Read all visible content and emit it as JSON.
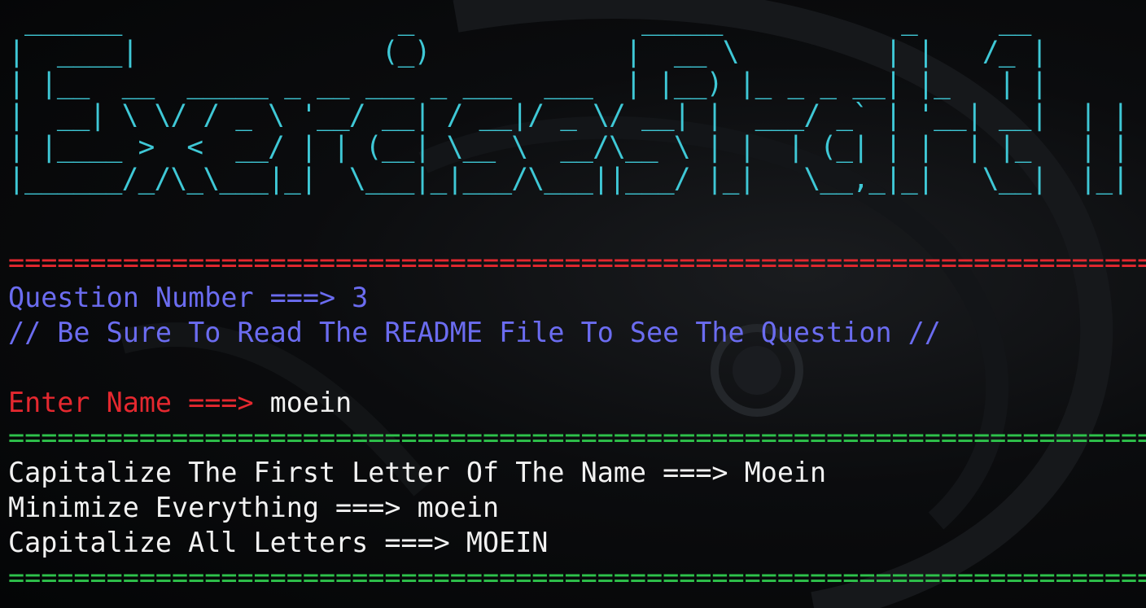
{
  "banner": {
    "text": " ______                 _              _____           _     __\n|  ____|               (_)            |  __ \\         | |   /_ |\n| |__  __  _____ _ __ ___ _ ___  ___  | |__) |_ _ _ __| |_   | |\n|  __| \\ \\/ / _ \\ '__/ __| / __|/ _ \\/ __| |  ___/ _` | '__| __|  | |\n| |____ >  <  __/ | | (__| \\__ \\  __/\\__ \\ | |  | (_| | |  | |_   | |\n|______/_/\\_\\___|_|  \\___|_|___/\\___||___/ |_|   \\__,_|_|   \\__|  |_|",
    "color": "#3fc8d6"
  },
  "separators": {
    "top": "===========================================================================================================",
    "green": "======================================================================================="
  },
  "question": {
    "number_line": "Question Number ===> 3",
    "note": "// Be Sure To Read The README File To See The Question //"
  },
  "input": {
    "prompt": "Enter Name ===> ",
    "value": "moein"
  },
  "results": [
    "Capitalize The First Letter Of The Name ===> Moein",
    "Minimize Everything ===> moein",
    "Capitalize All Letters ===> MOEIN"
  ],
  "colors": {
    "banner": "#3fc8d6",
    "red": "#e5282f",
    "blue": "#6b6cf0",
    "green": "#2ec24b",
    "white": "#f2f2f2"
  }
}
